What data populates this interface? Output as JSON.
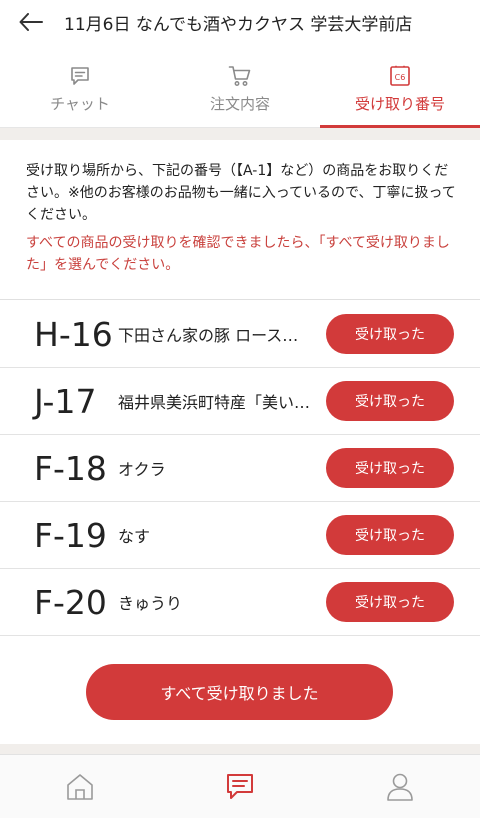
{
  "header": {
    "back_icon": "arrow-left-icon",
    "title": "11月6日 なんでも酒やカクヤス 学芸大学前店"
  },
  "tabs": [
    {
      "label": "チャット",
      "icon": "chat-icon",
      "active": false
    },
    {
      "label": "注文内容",
      "icon": "cart-icon",
      "active": false
    },
    {
      "label": "受け取り番号",
      "icon": "ticket-c6-icon",
      "icon_text": "C6",
      "active": true
    }
  ],
  "notice": {
    "text": "受け取り場所から、下記の番号（【A-1】など）の商品をお取りください。※他のお客様のお品物も一緒に入っているので、丁寧に扱ってください。",
    "highlight": "すべての商品の受け取りを確認できましたら、「すべて受け取りました」を選んでください。"
  },
  "items": [
    {
      "code": "H-16",
      "name": "下田さん家の豚 ロース…",
      "button": "受け取った"
    },
    {
      "code": "J-17",
      "name": "福井県美浜町特産「美い…",
      "button": "受け取った"
    },
    {
      "code": "F-18",
      "name": "オクラ",
      "button": "受け取った"
    },
    {
      "code": "F-19",
      "name": "なす",
      "button": "受け取った"
    },
    {
      "code": "F-20",
      "name": "きゅうり",
      "button": "受け取った"
    }
  ],
  "all_received_label": "すべて受け取りました",
  "bottom_nav": [
    {
      "icon": "home-icon",
      "active": false
    },
    {
      "icon": "chat-icon",
      "active": true
    },
    {
      "icon": "person-icon",
      "active": false
    }
  ],
  "colors": {
    "accent": "#d23a3a",
    "notice_red": "#c9413d",
    "inactive": "#8a8a8a"
  }
}
